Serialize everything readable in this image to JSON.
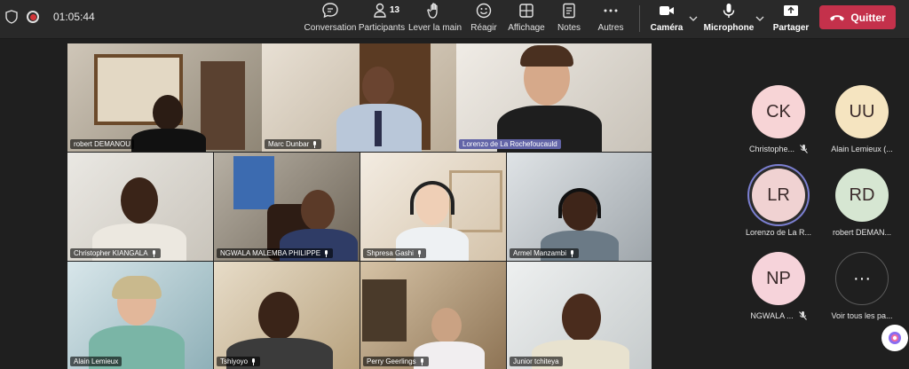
{
  "meeting": {
    "timer": "01:05:44"
  },
  "toolbar": {
    "chat_label": "Conversation",
    "participants_label": "Participants",
    "participants_count": "13",
    "raise_hand_label": "Lever la main",
    "react_label": "Réagir",
    "view_label": "Affichage",
    "notes_label": "Notes",
    "more_label": "Autres",
    "camera_label": "Caméra",
    "mic_label": "Microphone",
    "share_label": "Partager",
    "leave_label": "Quitter",
    "leave_color": "#c4314b"
  },
  "tiles": [
    {
      "name": "robert DEMANOU"
    },
    {
      "name": "Marc Dunbar"
    },
    {
      "name": "Lorenzo de La Rochefoucauld"
    },
    {
      "name": "Christopher KIANGALA"
    },
    {
      "name": "NGWALA MALEMBA PHILIPPE"
    },
    {
      "name": "Shpresa Gashi"
    },
    {
      "name": "Armel Manzambi"
    },
    {
      "name": "Alain Lemieux"
    },
    {
      "name": "Tshiyoyo"
    },
    {
      "name": "Perry Geerlings"
    },
    {
      "name": "Junior tchiteya"
    }
  ],
  "roster": [
    {
      "initials": "CK",
      "name": "Christophe...",
      "color": "#f7d4d6"
    },
    {
      "initials": "UU",
      "name": "Alain Lemieux (...",
      "color": "#f5e4c0"
    },
    {
      "initials": "LR",
      "name": "Lorenzo de La R...",
      "color": "#f0d2d2"
    },
    {
      "initials": "RD",
      "name": "robert DEMAN...",
      "color": "#d6e6d2"
    },
    {
      "initials": "NP",
      "name": "NGWALA ...",
      "color": "#f6d3da"
    },
    {
      "initials": "···",
      "name": "Voir tous les pa..."
    }
  ]
}
